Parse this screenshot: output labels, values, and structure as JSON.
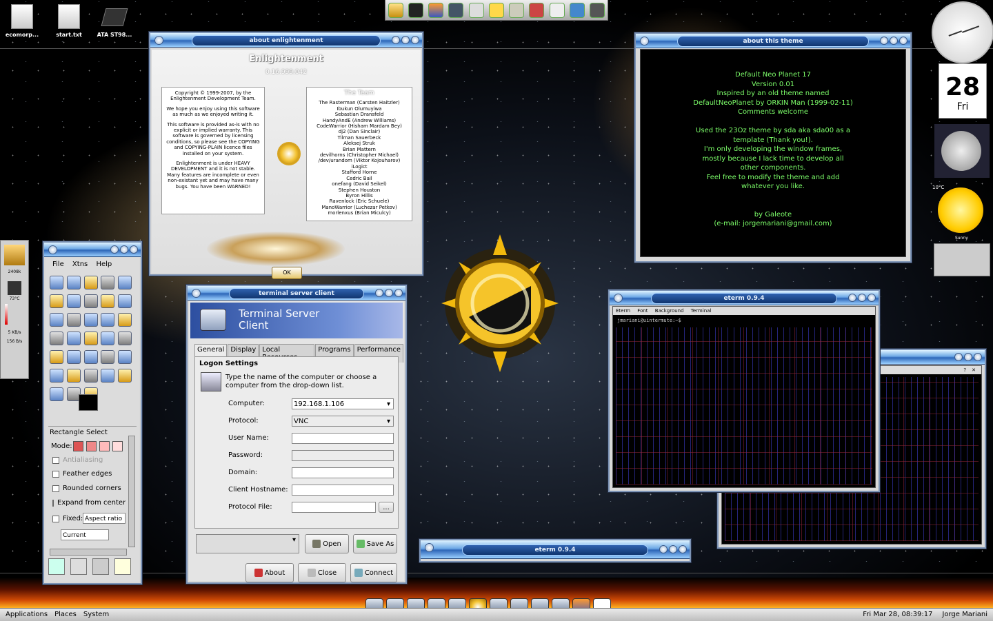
{
  "desktop": {
    "icons": [
      {
        "label": "ecomorp..."
      },
      {
        "label": "start.txt"
      },
      {
        "label": "ATA ST98..."
      }
    ]
  },
  "quicklaunch": {
    "icons": [
      "e-icon",
      "terminal-icon",
      "firefox-icon",
      "files-icon",
      "fetch-icon",
      "easytag-icon",
      "book-icon",
      "network-icon",
      "clock-icon",
      "globe-icon",
      "camera-icon"
    ]
  },
  "about_window": {
    "title": "about enlightenment",
    "app_name": "Enlightenment",
    "version": "0.16.999.042",
    "left_panel": [
      "Copyright © 1999-2007, by the Enlightenment Development Team.",
      "We hope you enjoy using this software as much as we enjoyed writing it.",
      "This software is provided as-is with no explicit or implied warranty. This software is governed by licensing conditions, so please see the COPYING and COPYING-PLAIN licence files installed on your system.",
      "Enlightenment is under HEAVY DEVELOPMENT and it is not stable. Many features are incomplete or even non-existant yet and may have many bugs. You have been WARNED!"
    ],
    "team_heading": "The Team",
    "team": [
      "The Rasterman (Carsten Haitzler)",
      "Ibukun Olumuyiwa",
      "Sebastian Dransfeld",
      "HandyAndE (Andrew Williams)",
      "CodeWarrior (Hisham Mardam Bey)",
      "dj2 (Dan Sinclair)",
      "Tilman Sauerbeck",
      "Aleksej Struk",
      "Brian Mattern",
      "devilhorns (Christopher Michael)",
      "/dev/urandom (Viktor Kojouharov)",
      "iLogict",
      "Stafford Horne",
      "Cedric Bail",
      "onefang (David Seikel)",
      "Stephen Houston",
      "Byron Hillis",
      "Ravenlock (Eric Schuele)",
      "ManoWarrior (Luchezar Petkov)",
      "morlenxus (Brian Miculcy)"
    ],
    "ok_label": "OK"
  },
  "theme_window": {
    "title": "about this theme",
    "lines": [
      "Default Neo Planet 17",
      "Version 0.01",
      "Inspired by an old theme named",
      "DefaultNeoPlanet by ORKIN Man (1999-02-11)",
      "Comments welcome",
      "",
      "Used the 23Oz theme by sda aka sda00 as a",
      "template (Thank you!).",
      "I'm only developing the window frames,",
      "mostly because I lack time to develop all",
      "other components.",
      "Feel free to modify the theme and add",
      "whatever you like.",
      "",
      "",
      "by Galeote",
      "(e-mail: jorgemariani@gmail.com)"
    ]
  },
  "gimp": {
    "menu": [
      "File",
      "Xtns",
      "Help"
    ],
    "tool_options_title": "Rectangle Select",
    "mode_label": "Mode:",
    "antialiasing": "Antialiasing",
    "feather": "Feather edges",
    "rounded": "Rounded corners",
    "expand": "Expand from center",
    "fixed_label": "Fixed:",
    "fixed_value": "Aspect ratio",
    "current": "Current"
  },
  "tsc": {
    "title": "terminal server client",
    "banner": "Terminal Server\nClient",
    "tabs": [
      "General",
      "Display",
      "Local Resources",
      "Programs",
      "Performance"
    ],
    "section": "Logon Settings",
    "help": "Type the name of the computer or choose a computer from the drop-down list.",
    "fields": {
      "computer_label": "Computer:",
      "computer_value": "192.168.1.106",
      "protocol_label": "Protocol:",
      "protocol_value": "VNC",
      "username_label": "User Name:",
      "password_label": "Password:",
      "domain_label": "Domain:",
      "client_host_label": "Client Hostname:",
      "protocol_file_label": "Protocol File:",
      "browse": "..."
    },
    "buttons": {
      "open": "Open",
      "save_as": "Save As",
      "about": "About",
      "close": "Close",
      "connect": "Connect"
    }
  },
  "eterm_main": {
    "title": "eterm 0.9.4",
    "menu": [
      "Eterm",
      "Font",
      "Background",
      "Terminal"
    ],
    "prompt": "jmariani@uintermute:~$"
  },
  "eterm_min": {
    "title": "eterm 0.9.4"
  },
  "widgets": {
    "date_day": "28",
    "date_weekday": "Fri",
    "temp": "10°C",
    "condition": "Sunny"
  },
  "leftbar": {
    "cpu": "2408k",
    "temp": "73°C",
    "net_up": "5 KB/s",
    "net_down": "156 B/s"
  },
  "taskbar": {
    "menus": [
      "Applications",
      "Places",
      "System"
    ],
    "clock": "Fri Mar 28, 08:39:17",
    "user": "Jorge Mariani"
  },
  "colors": {
    "title_blue": "#2d66b8",
    "theme_text": "#7dff6a",
    "desktop": "#000000"
  }
}
